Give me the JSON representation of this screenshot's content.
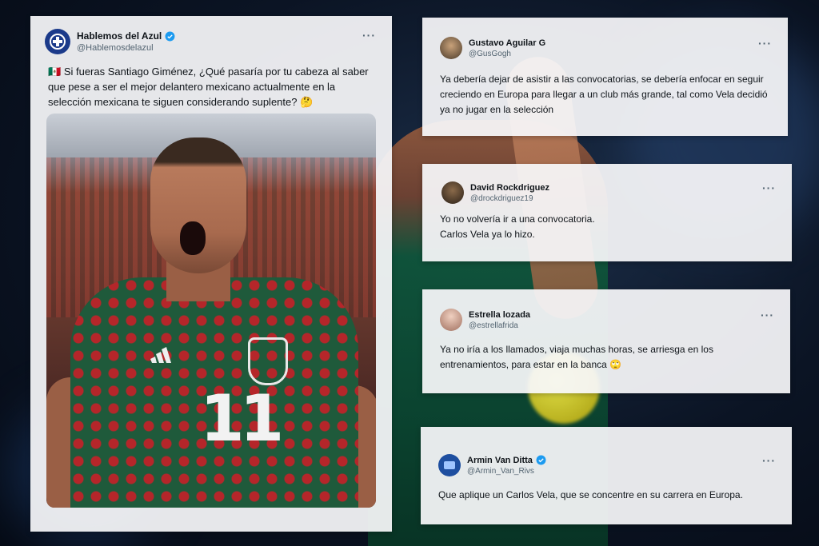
{
  "main_post": {
    "author_name": "Hablemos del Azul",
    "author_handle": "@Hablemosdelazul",
    "flag": "🇲🇽",
    "text": "Si fueras Santiago Giménez, ¿Qué pasaría por tu cabeza al saber que pese a ser el mejor delantero mexicano actualmente en la selección mexicana te siguen considerando suplente? 🤔",
    "media_jersey_number": "11"
  },
  "replies": [
    {
      "author_name": "Gustavo Aguilar G",
      "author_handle": "@GusGogh",
      "text": "Ya debería dejar de asistir a las convocatorias, se debería enfocar en seguir creciendo en Europa para llegar a un club más grande, tal como Vela decidió ya no jugar en la selección"
    },
    {
      "author_name": "David Rockdriguez",
      "author_handle": "@drockdriguez19",
      "text_line1": "Yo no volvería ir a una convocatoria.",
      "text_line2": "Carlos Vela ya lo hizo."
    },
    {
      "author_name": "Estrella lozada",
      "author_handle": "@estrellafrida",
      "text": "Ya no iría a los llamados, viaja muchas horas, se arriesga en los entrenamientos, para estar en la banca 🙄"
    },
    {
      "author_name": "Armin Van Ditta",
      "author_handle": "@Armin_Van_Rivs",
      "text": "Que aplique un Carlos Vela, que se concentre en su carrera en Europa."
    }
  ],
  "more_label": "···",
  "icons": {
    "verified": "verified-badge-icon",
    "more": "more-options-icon"
  },
  "colors": {
    "verified_blue": "#1d9bf0",
    "card_bg": "#f7f8fa",
    "text": "#0f1419",
    "handle": "#536471"
  }
}
